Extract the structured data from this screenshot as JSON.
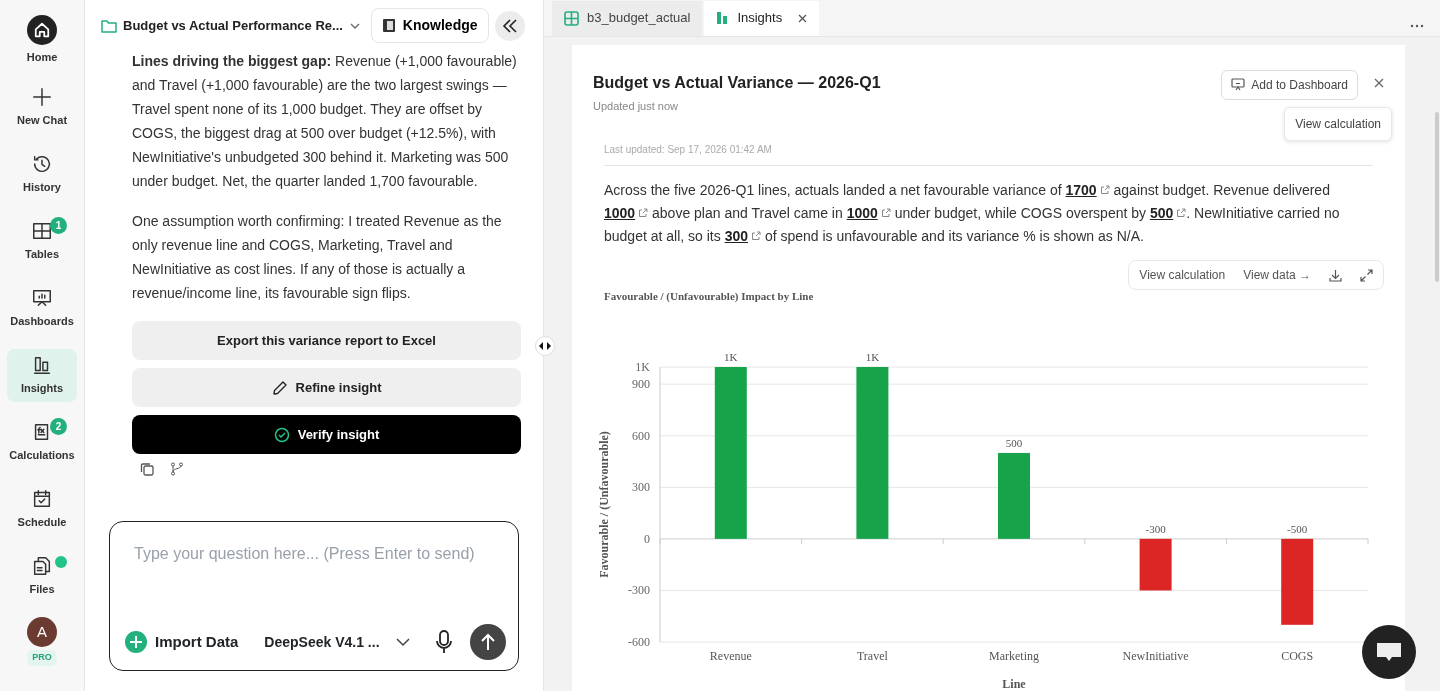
{
  "rail": [
    {
      "label": "Home",
      "selected": false
    },
    {
      "label": "New Chat",
      "selected": false
    },
    {
      "label": "History",
      "selected": false
    },
    {
      "label": "Tables",
      "selected": false,
      "badge": "1"
    },
    {
      "label": "Dashboards",
      "selected": false
    },
    {
      "label": "Insights",
      "selected": true
    },
    {
      "label": "Calculations",
      "selected": false,
      "badge": "2"
    },
    {
      "label": "Schedule",
      "selected": false
    },
    {
      "label": "Files",
      "selected": false,
      "dot": true
    }
  ],
  "user": {
    "initial": "A",
    "plan": "PRO"
  },
  "chat": {
    "title": "Budget vs Actual Performance Re...",
    "knowledge": "Knowledge",
    "paragraphs": [
      "**Lines driving the biggest gap:** Revenue (+1,000 favourable) and Travel (+1,000 favourable) are the two largest swings — Travel spent none of its 1,000 budget. They are offset by COGS, the biggest drag at 500 over budget (+12.5%), with NewInitiative's unbudgeted 300 behind it. Marketing was 500 under budget. Net, the quarter landed 1,700 favourable.",
      "One assumption worth confirming: I treated Revenue as the only revenue line and COGS, Marketing, Travel and NewInitiative as cost lines. If any of those is actually a revenue/income line, its favourable sign flips."
    ],
    "actions": [
      {
        "kind": "plain",
        "label": "Export this variance report to Excel"
      },
      {
        "kind": "edit",
        "label": "Refine insight"
      },
      {
        "kind": "verify",
        "label": "Verify insight"
      }
    ],
    "input": {
      "placeholder": "Type your question here... (Press Enter to send)",
      "import": "Import Data",
      "model": "DeepSeek V4.1 ..."
    }
  },
  "tabs": [
    {
      "label": "b3_budget_actual",
      "selected": false
    },
    {
      "label": "Insights",
      "selected": true
    }
  ],
  "insight": {
    "title": "Budget vs Actual Variance — 2026-Q1",
    "updated": "Updated just now",
    "add": "Add to Dashboard",
    "view_calc_popup": "View calculation",
    "last_updated": "Last updated: Sep 17, 2026 01:42 AM",
    "summary": [
      {
        "kind": "text",
        "text": "Across the five 2026-Q1 lines, actuals landed a net favourable variance of "
      },
      {
        "kind": "link",
        "text": "1700"
      },
      {
        "kind": "text",
        "text": " against budget. Revenue delivered "
      },
      {
        "kind": "link",
        "text": "1000"
      },
      {
        "kind": "text",
        "text": " above plan and Travel came in "
      },
      {
        "kind": "link",
        "text": "1000"
      },
      {
        "kind": "text",
        "text": " under budget, while COGS overspent by "
      },
      {
        "kind": "link",
        "text": "500"
      },
      {
        "kind": "text",
        "text": ". NewInitiative carried no budget at all, so its "
      },
      {
        "kind": "link",
        "text": "300"
      },
      {
        "kind": "text",
        "text": " of spend is unfavourable and its variance % is shown as N/A."
      }
    ],
    "toolbar": {
      "view_calc": "View calculation",
      "view_data": "View data →"
    },
    "chart_data": {
      "type": "bar",
      "title": "Favourable / (Unfavourable) Impact by Line",
      "xlabel": "Line",
      "ylabel": "Favourable / (Unfavourable)",
      "categories": [
        "Revenue",
        "Travel",
        "Marketing",
        "NewInitiative",
        "COGS"
      ],
      "stacked": true,
      "grid": true,
      "series": [
        {
          "color": "#16a34a",
          "values": [
            1000,
            1000,
            500,
            null,
            null
          ]
        },
        {
          "color": "#dc2626",
          "values": [
            null,
            null,
            null,
            -300,
            -500
          ]
        }
      ],
      "ylim": [
        -600,
        1000
      ],
      "yticks": [
        -600,
        -300,
        0,
        300,
        600,
        900,
        {
          "value": 1000,
          "label": "1K"
        }
      ],
      "value_labels": [
        "1K",
        "1K",
        "500",
        "-300",
        "-500"
      ]
    }
  }
}
